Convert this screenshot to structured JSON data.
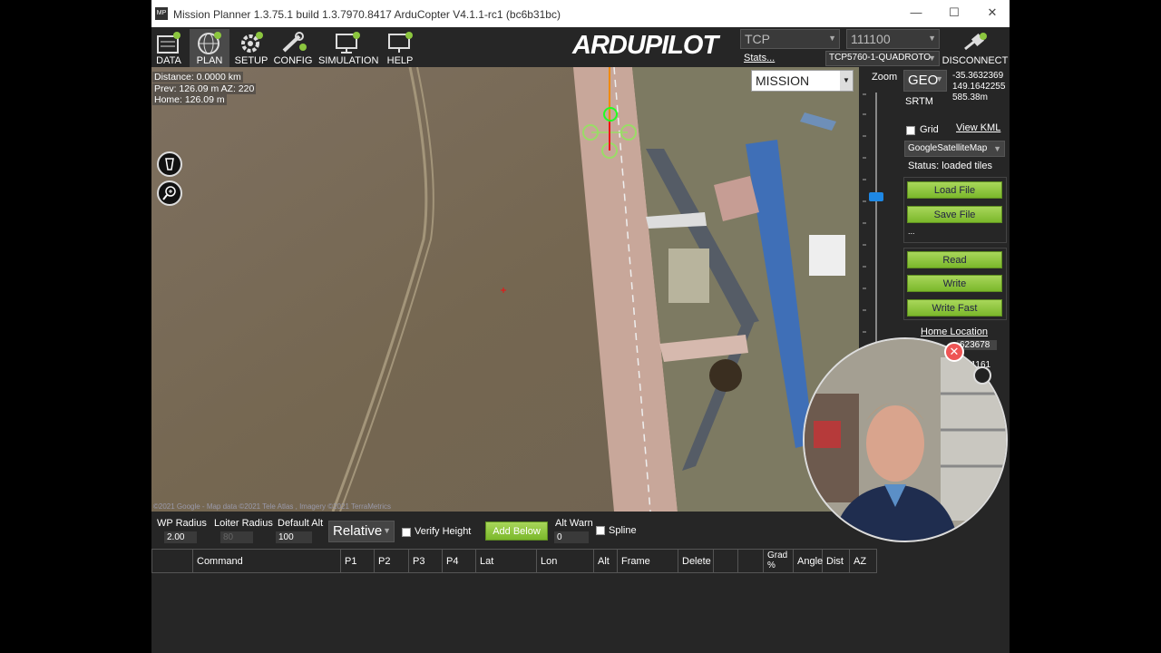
{
  "window": {
    "title": "Mission Planner 1.3.75.1 build 1.3.7970.8417 ArduCopter V4.1.1-rc1 (bc6b31bc)",
    "app_icon_text": "MP"
  },
  "toolbar": {
    "items": [
      {
        "label": "DATA",
        "icon": "data-icon"
      },
      {
        "label": "PLAN",
        "icon": "globe-icon"
      },
      {
        "label": "SETUP",
        "icon": "gear-icon"
      },
      {
        "label": "CONFIG",
        "icon": "wrench-icon"
      },
      {
        "label": "SIMULATION",
        "icon": "monitor-icon"
      },
      {
        "label": "HELP",
        "icon": "help-icon"
      }
    ],
    "logo_a": "ARDU",
    "logo_b": "PILOT",
    "connection_type": "TCP",
    "baud": "111100",
    "stats_link": "Stats...",
    "vehicle": "TCP5760-1-QUADROTO",
    "disconnect_label": "DISCONNECT"
  },
  "map": {
    "distance": "Distance: 0.0000 km",
    "prev": "Prev: 126.09 m AZ: 220",
    "home": "Home: 126.09 m",
    "mode": "MISSION",
    "copyright": "©2021 Google - Map data ©2021 Tele Atlas , Imagery ©2021 TerraMetrics"
  },
  "zoom": {
    "label": "Zoom",
    "level": 0.75
  },
  "right_panel": {
    "coord_system": "GEO",
    "lat": "-35.3632369",
    "lon": "149.1642255",
    "alt": "585.38m",
    "srtm": "SRTM",
    "grid_label": "Grid",
    "view_kml": "View KML",
    "map_provider": "GoogleSatelliteMap",
    "status": "Status: loaded tiles",
    "load_file": "Load File",
    "save_file": "Save File",
    "ellipsis": "...",
    "read": "Read",
    "write": "Write",
    "write_fast": "Write Fast",
    "home_location": "Home Location",
    "home_lat_partial": "623678",
    "home_lon_partial": "51161"
  },
  "bottom": {
    "wp_radius_label": "WP Radius",
    "wp_radius": "2.00",
    "loiter_radius_label": "Loiter Radius",
    "loiter_radius": "80",
    "default_alt_label": "Default Alt",
    "default_alt": "100",
    "alt_frame": "Relative",
    "verify_height": "Verify Height",
    "add_below": "Add Below",
    "alt_warn_label": "Alt Warn",
    "alt_warn": "0",
    "spline": "Spline"
  },
  "table": {
    "columns": [
      "",
      "Command",
      "P1",
      "P2",
      "P3",
      "P4",
      "Lat",
      "Lon",
      "Alt",
      "Frame",
      "Delete",
      "",
      "",
      "Grad %",
      "Angle",
      "Dist",
      "AZ"
    ]
  },
  "colors": {
    "accent_green": "#8cc63f",
    "map": "#7a6c58"
  }
}
